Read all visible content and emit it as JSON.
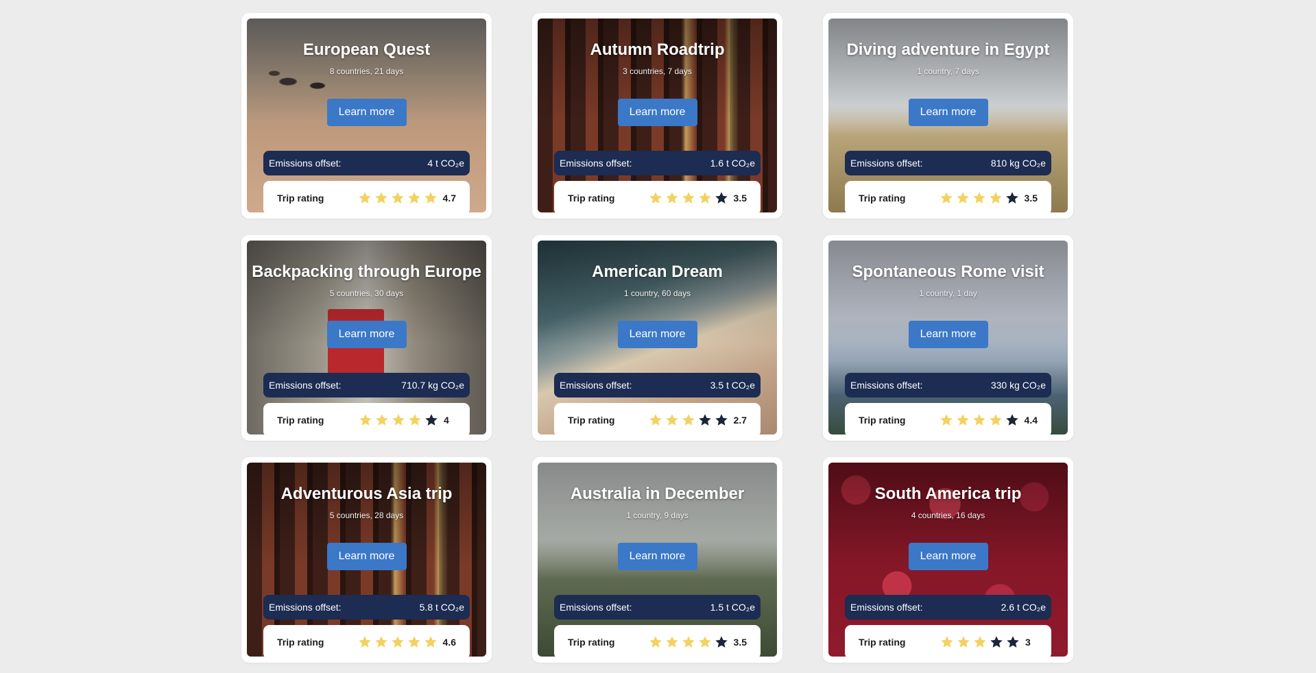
{
  "trips": [
    {
      "title": "European Quest",
      "subtitle": "8 countries, 21 days",
      "button": "Learn more",
      "emissions_label": "Emissions offset:",
      "emissions_value": "4 t CO₂e",
      "rating_label": "Trip rating",
      "rating": 4.7,
      "rating_text": "4.7",
      "stars_filled": 5,
      "image": "sand-beach-stones"
    },
    {
      "title": "Autumn Roadtrip",
      "subtitle": "3 countries, 7 days",
      "button": "Learn more",
      "emissions_label": "Emissions offset:",
      "emissions_value": "1.6 t CO₂e",
      "rating_label": "Trip rating",
      "rating": 3.5,
      "rating_text": "3.5",
      "stars_filled": 4,
      "image": "stone-arches"
    },
    {
      "title": "Diving adventure in Egypt",
      "subtitle": "1 country, 7 days",
      "button": "Learn more",
      "emissions_label": "Emissions offset:",
      "emissions_value": "810 kg CO₂e",
      "rating_label": "Trip rating",
      "rating": 3.5,
      "rating_text": "3.5",
      "stars_filled": 4,
      "image": "beach-lifeguard-chair"
    },
    {
      "title": "Backpacking through Europe",
      "subtitle": "5 countries, 30 days",
      "button": "Learn more",
      "emissions_label": "Emissions offset:",
      "emissions_value": "710.7 kg CO₂e",
      "rating_label": "Trip rating",
      "rating": 4,
      "rating_text": "4",
      "stars_filled": 4,
      "image": "street-red-tram"
    },
    {
      "title": "American Dream",
      "subtitle": "1 country, 60 days",
      "button": "Learn more",
      "emissions_label": "Emissions offset:",
      "emissions_value": "3.5 t CO₂e",
      "rating_label": "Trip rating",
      "rating": 2.7,
      "rating_text": "2.7",
      "stars_filled": 3,
      "image": "ocean-waves-shore"
    },
    {
      "title": "Spontaneous Rome visit",
      "subtitle": "1 country, 1 day",
      "button": "Learn more",
      "emissions_label": "Emissions offset:",
      "emissions_value": "330 kg CO₂e",
      "rating_label": "Trip rating",
      "rating": 4.4,
      "rating_text": "4.4",
      "stars_filled": 4,
      "image": "cloudy-mountains"
    },
    {
      "title": "Adventurous Asia trip",
      "subtitle": "5 countries, 28 days",
      "button": "Learn more",
      "emissions_label": "Emissions offset:",
      "emissions_value": "5.8 t CO₂e",
      "rating_label": "Trip rating",
      "rating": 4.6,
      "rating_text": "4.6",
      "stars_filled": 5,
      "image": "stone-arches"
    },
    {
      "title": "Australia in December",
      "subtitle": "1 country, 9 days",
      "button": "Learn more",
      "emissions_label": "Emissions offset:",
      "emissions_value": "1.5 t CO₂e",
      "rating_label": "Trip rating",
      "rating": 3.5,
      "rating_text": "3.5",
      "stars_filled": 4,
      "image": "dandelion-meadow"
    },
    {
      "title": "South America trip",
      "subtitle": "4 countries, 16 days",
      "button": "Learn more",
      "emissions_label": "Emissions offset:",
      "emissions_value": "2.6 t CO₂e",
      "rating_label": "Trip rating",
      "rating": 3,
      "rating_text": "3",
      "stars_filled": 3,
      "image": "strawberries"
    }
  ],
  "colors": {
    "page_bg": "#ececec",
    "button": "#3b78c7",
    "emissions_bar": "#1c2c52",
    "star_filled": "#f2d260",
    "star_empty": "#1c2438"
  },
  "icons": {
    "star": "star-icon"
  }
}
